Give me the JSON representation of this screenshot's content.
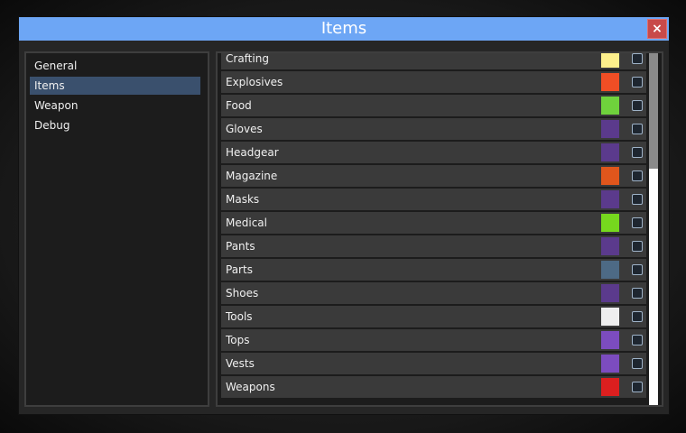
{
  "window": {
    "title": "Items",
    "close_label": "×"
  },
  "sidebar": {
    "items": [
      {
        "label": "General",
        "active": false
      },
      {
        "label": "Items",
        "active": true
      },
      {
        "label": "Weapon",
        "active": false
      },
      {
        "label": "Debug",
        "active": false
      }
    ]
  },
  "categories": [
    {
      "label": "Crafting",
      "color": "#fdf08c",
      "checked": false
    },
    {
      "label": "Explosives",
      "color": "#f04e25",
      "checked": false
    },
    {
      "label": "Food",
      "color": "#6fd23c",
      "checked": false
    },
    {
      "label": "Gloves",
      "color": "#5b3a8c",
      "checked": false
    },
    {
      "label": "Headgear",
      "color": "#5b3a8c",
      "checked": false
    },
    {
      "label": "Magazine",
      "color": "#e0561c",
      "checked": false
    },
    {
      "label": "Masks",
      "color": "#5b3a8c",
      "checked": false
    },
    {
      "label": "Medical",
      "color": "#76d81e",
      "checked": false
    },
    {
      "label": "Pants",
      "color": "#5b3a8c",
      "checked": false
    },
    {
      "label": "Parts",
      "color": "#4d6a85",
      "checked": false
    },
    {
      "label": "Shoes",
      "color": "#5b3a8c",
      "checked": false
    },
    {
      "label": "Tools",
      "color": "#eeeeee",
      "checked": false
    },
    {
      "label": "Tops",
      "color": "#7c4cbf",
      "checked": false
    },
    {
      "label": "Vests",
      "color": "#7c4cbf",
      "checked": false
    },
    {
      "label": "Weapons",
      "color": "#dc1f1f",
      "checked": false
    }
  ],
  "scroll": {
    "position": 0
  },
  "colors": {
    "titlebar": "#6da6f5",
    "close_button": "#c84a4a",
    "active_nav": "#3a506d"
  }
}
